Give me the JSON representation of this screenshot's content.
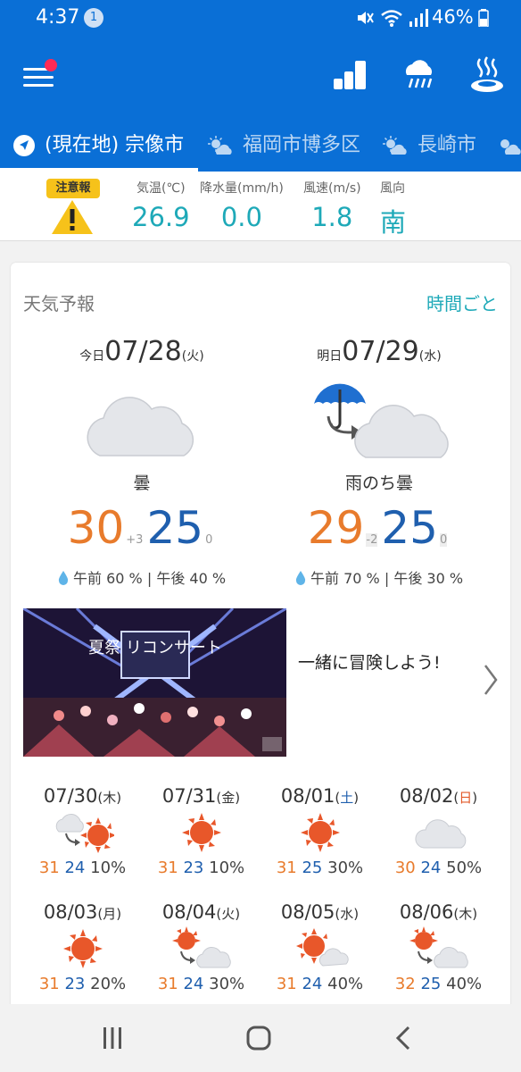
{
  "status_bar": {
    "time": "4:37",
    "notification_count": "1",
    "battery": "46%"
  },
  "app_bar": {
    "icons": [
      "menu-icon",
      "ranking-icon",
      "rain-cloud-icon",
      "onsen-icon"
    ]
  },
  "tabs": [
    {
      "label": "(現在地) 宗像市",
      "icon": "location-arrow-icon",
      "active": true
    },
    {
      "label": "福岡市博多区",
      "icon": "sun-cloud-icon",
      "active": false
    },
    {
      "label": "長崎市",
      "icon": "sun-cloud-icon",
      "active": false
    }
  ],
  "observation": {
    "warning_label": "注意報",
    "temperature": {
      "label": "気温(℃)",
      "value": "26.9"
    },
    "precipitation": {
      "label": "降水量(mm/h)",
      "value": "0.0"
    },
    "wind_speed": {
      "label": "風速(m/s)",
      "value": "1.8"
    },
    "wind_direction": {
      "label": "風向",
      "value": "南"
    }
  },
  "forecast": {
    "title": "天気予報",
    "hourly_link": "時間ごと",
    "today": {
      "prefix": "今日",
      "date": "07/28",
      "weekday": "(火)",
      "weather": "曇",
      "high": "30",
      "high_diff": "+3",
      "low": "25",
      "low_diff": "0",
      "rain_am": "午前 60 %",
      "rain_pm": "午後 40 %"
    },
    "tomorrow": {
      "prefix": "明日",
      "date": "07/29",
      "weekday": "(水)",
      "weather": "雨のち曇",
      "high": "29",
      "high_diff": "-2",
      "low": "25",
      "low_diff": "0",
      "rain_am": "午前 70 %",
      "rain_pm": "午後 30 %"
    }
  },
  "ad": {
    "text": "一緒に冒険しよう!",
    "banner_text": "夏祭 リコンサート"
  },
  "weekly": [
    {
      "date": "07/30",
      "weekday": "木",
      "icon": "cloud-then-sun",
      "high": "31",
      "low": "24",
      "pop": "10%"
    },
    {
      "date": "07/31",
      "weekday": "金",
      "icon": "sun",
      "high": "31",
      "low": "23",
      "pop": "10%"
    },
    {
      "date": "08/01",
      "weekday": "土",
      "icon": "sun",
      "high": "31",
      "low": "25",
      "pop": "30%"
    },
    {
      "date": "08/02",
      "weekday": "日",
      "icon": "cloud",
      "high": "30",
      "low": "24",
      "pop": "50%"
    },
    {
      "date": "08/03",
      "weekday": "月",
      "icon": "sun",
      "high": "31",
      "low": "23",
      "pop": "20%"
    },
    {
      "date": "08/04",
      "weekday": "火",
      "icon": "sun-then-cloud",
      "high": "31",
      "low": "24",
      "pop": "30%"
    },
    {
      "date": "08/05",
      "weekday": "水",
      "icon": "sun-with-cloud",
      "high": "31",
      "low": "24",
      "pop": "40%"
    },
    {
      "date": "08/06",
      "weekday": "木",
      "icon": "sun-then-cloud",
      "high": "32",
      "low": "25",
      "pop": "40%"
    }
  ],
  "colors": {
    "primary": "#0a6fd6",
    "teal": "#1ea9b8",
    "high_temp": "#e87b2c",
    "low_temp": "#1f5fae",
    "warning": "#f6c21a"
  }
}
